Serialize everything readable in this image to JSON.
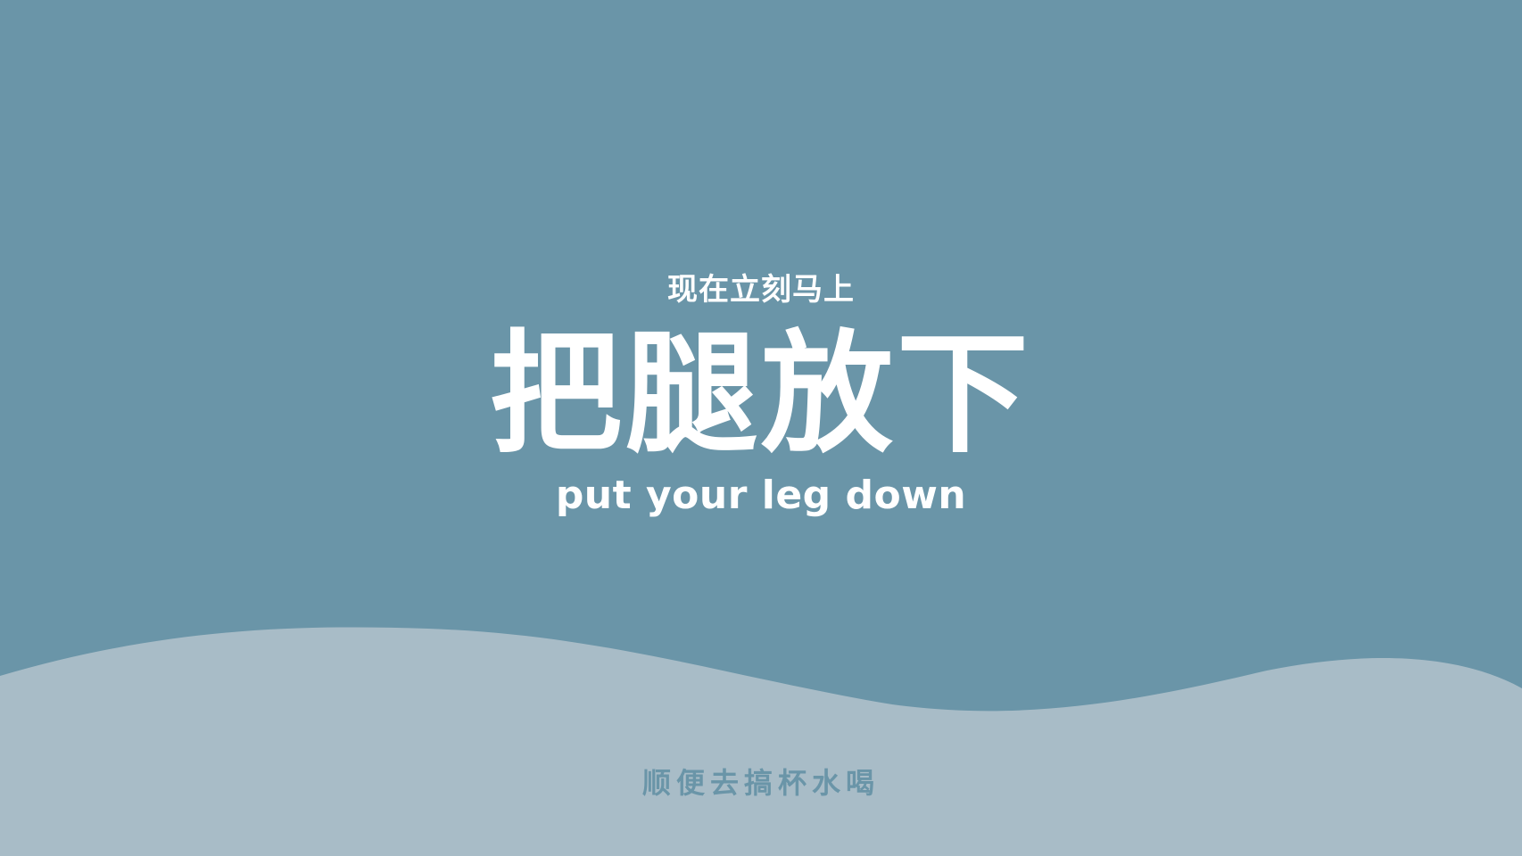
{
  "colors": {
    "background": "#6a95a8",
    "wave": "#a8bcc7",
    "text": "#ffffff",
    "bottom_text": "#6a95a8"
  },
  "poster": {
    "top_line": "现在立刻马上",
    "headline": "把腿放下",
    "english_line": "put your leg down",
    "bottom_line": "顺便去搞杯水喝"
  }
}
